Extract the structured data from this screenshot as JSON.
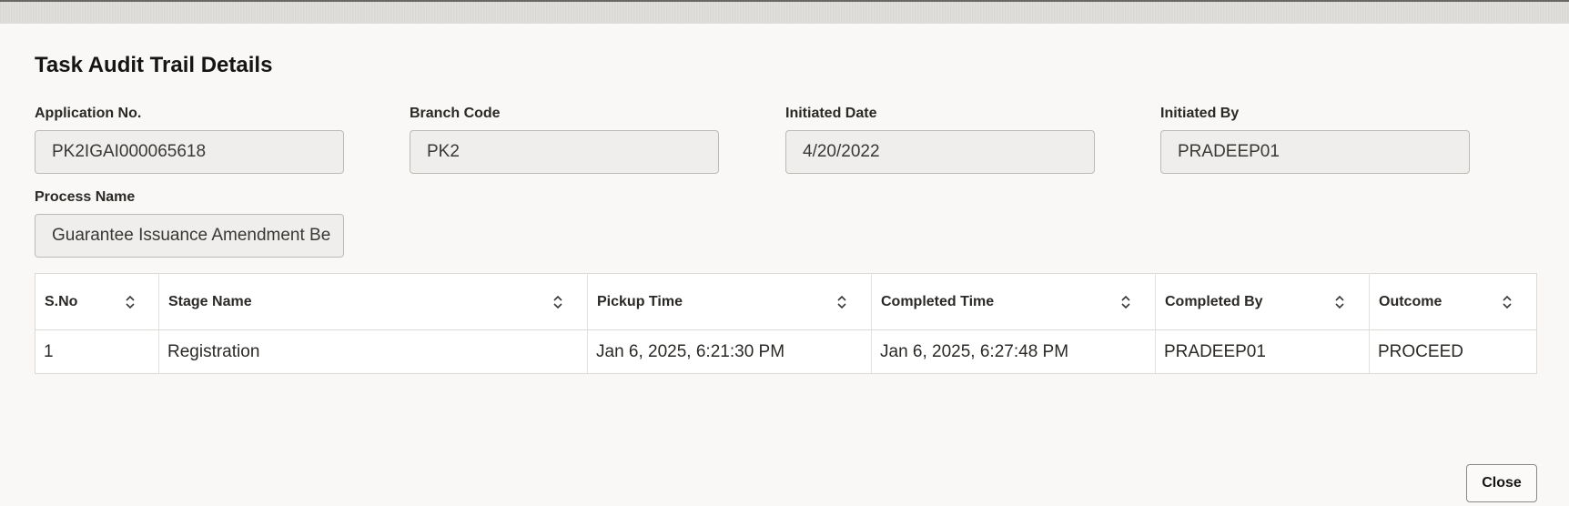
{
  "dialog": {
    "title": "Task Audit Trail Details"
  },
  "fields": {
    "application_no": {
      "label": "Application No.",
      "value": "PK2IGAI000065618"
    },
    "branch_code": {
      "label": "Branch Code",
      "value": "PK2"
    },
    "initiated_date": {
      "label": "Initiated Date",
      "value": "4/20/2022"
    },
    "initiated_by": {
      "label": "Initiated By",
      "value": "PRADEEP01"
    },
    "process_name": {
      "label": "Process Name",
      "value": "Guarantee Issuance Amendment Be"
    }
  },
  "table": {
    "columns": [
      "S.No",
      "Stage Name",
      "Pickup Time",
      "Completed Time",
      "Completed By",
      "Outcome"
    ],
    "rows": [
      [
        "1",
        "Registration",
        "Jan 6, 2025, 6:21:30 PM",
        "Jan 6, 2025, 6:27:48 PM",
        "PRADEEP01",
        "PROCEED"
      ]
    ]
  },
  "footer": {
    "close_label": "Close"
  },
  "icons": {
    "sort": "sort-updown-icon"
  },
  "colors": {
    "background": "#f9f8f6",
    "input_fill": "#efeeec",
    "text": "#161513"
  }
}
